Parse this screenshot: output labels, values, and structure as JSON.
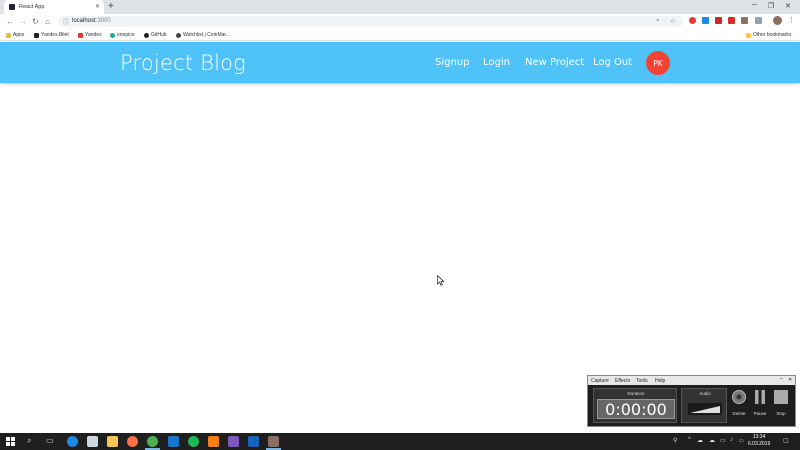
{
  "browser": {
    "tab_title": "React App",
    "url_host": "localhost",
    "url_port": ":3000",
    "bookmarks": [
      {
        "label": "Apps",
        "color": "#e0c14c"
      },
      {
        "label": "Yandex.Bilet",
        "color": "#222222"
      },
      {
        "label": "Yandex",
        "color": "#e53935"
      },
      {
        "label": "onepice",
        "color": "#26a69a"
      },
      {
        "label": "GitHub",
        "color": "#222222"
      },
      {
        "label": "Watchlist | CoinMar...",
        "color": "#444444"
      }
    ],
    "other_bookmarks": "Other bookmarks"
  },
  "app": {
    "brand": "Project Blog",
    "header_color": "#4fc3f7",
    "nav": [
      {
        "label": "Signup"
      },
      {
        "label": "Login"
      },
      {
        "label": "New Project"
      },
      {
        "label": "Log Out"
      }
    ],
    "avatar_initials": "PK",
    "avatar_color": "#f44336"
  },
  "recorder": {
    "menu": [
      "Capture",
      "Effects",
      "Tools",
      "Help"
    ],
    "duration_label": "Duration",
    "duration_value": "0:00:00",
    "audio_label": "Audio",
    "buttons": [
      {
        "label": "Delete",
        "icon": "delete-icon"
      },
      {
        "label": "Pause",
        "icon": "pause-icon"
      },
      {
        "label": "Stop",
        "icon": "stop-icon"
      }
    ]
  },
  "taskbar": {
    "time": "13:34",
    "date": "6.03.2019"
  }
}
